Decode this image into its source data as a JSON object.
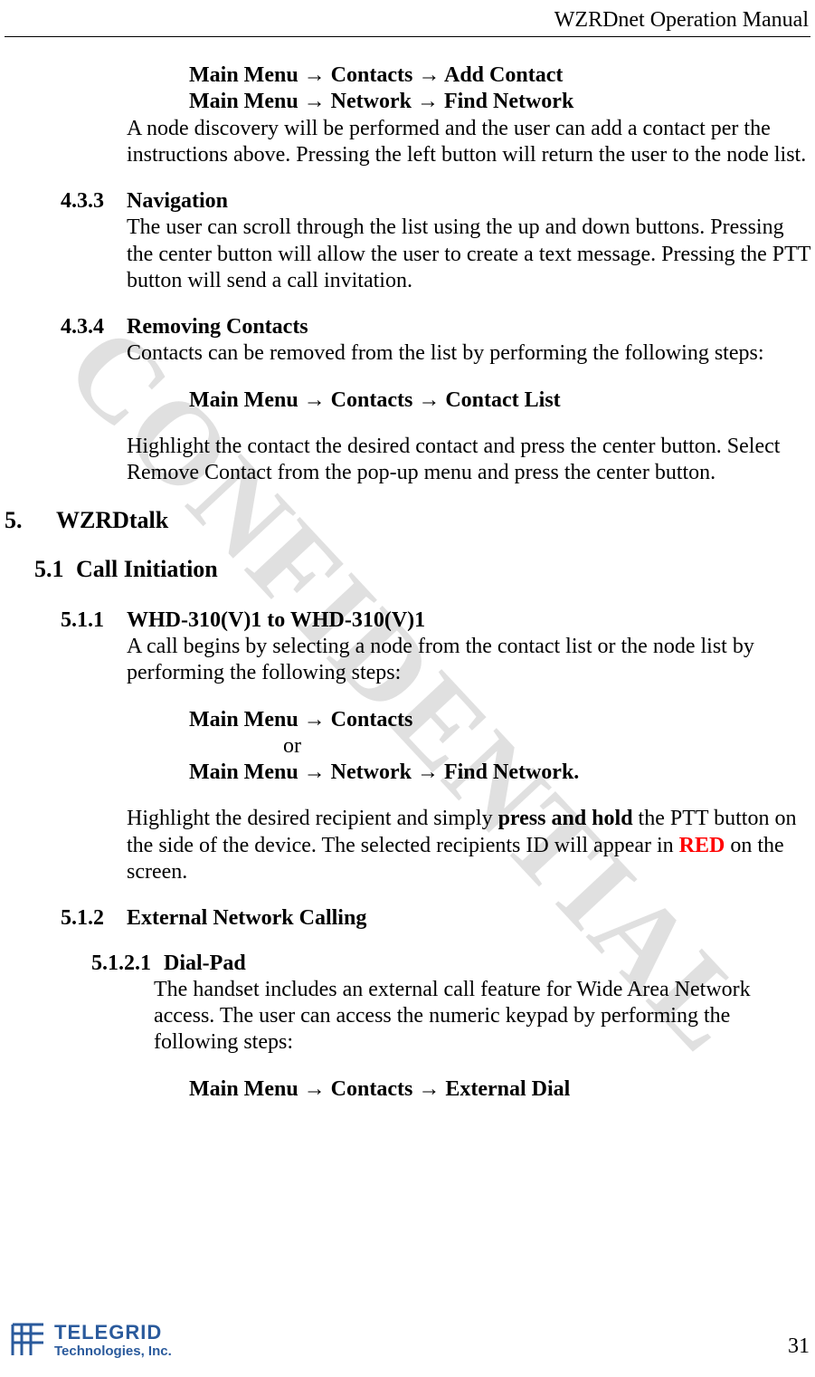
{
  "header": {
    "title": "WZRDnet Operation Manual"
  },
  "watermark": "CONFIDENTIAL",
  "paths": {
    "addContact": "Main Menu → Contacts → Add Contact",
    "findNetwork": "Main Menu → Network → Find Network",
    "contactList": "Main Menu → Contacts → Contact List",
    "contacts": "Main Menu → Contacts",
    "or": "or",
    "findNetworkDot": "Main Menu → Network → Find Network.",
    "externalDial": "Main Menu → Contacts → External Dial"
  },
  "sec432": {
    "body": "A node discovery will be performed and the user can add a contact per the instructions above.  Pressing the left button will return the user to the node list."
  },
  "sec433": {
    "num": "4.3.3",
    "title": "Navigation",
    "body": "The user can scroll through the list using the up and down buttons.  Pressing the center button will allow the user to create a text message.  Pressing the PTT button will send a call invitation."
  },
  "sec434": {
    "num": "4.3.4",
    "title": "Removing Contacts",
    "body1": "Contacts can be removed from the list by performing the following steps:",
    "body2": "Highlight the contact the desired contact and press the center button.  Select Remove Contact from the pop-up menu and press the center button."
  },
  "sec5": {
    "num": "5.",
    "title": "WZRDtalk"
  },
  "sec51": {
    "num": "5.1",
    "title": "Call Initiation"
  },
  "sec511": {
    "num": "5.1.1",
    "title": "WHD-310(V)1 to WHD-310(V)1",
    "body1": "A call begins by selecting a node from the contact list or the node list by performing the following steps:",
    "body2a": "Highlight the desired recipient and simply ",
    "body2bold": "press and hold",
    "body2b": " the PTT button on the side of the device.  The selected recipients ID will appear in ",
    "body2red": "RED",
    "body2c": " on the screen."
  },
  "sec512": {
    "num": "5.1.2",
    "title": "External Network Calling"
  },
  "sec5121": {
    "num": "5.1.2.1",
    "title": "Dial-Pad",
    "body": "The handset includes an external call feature for Wide Area Network access.  The user can access the numeric keypad by performing the following steps:"
  },
  "footer": {
    "logoLine1": "TELEGRID",
    "logoLine2": "Technologies, Inc.",
    "pageNum": "31"
  }
}
